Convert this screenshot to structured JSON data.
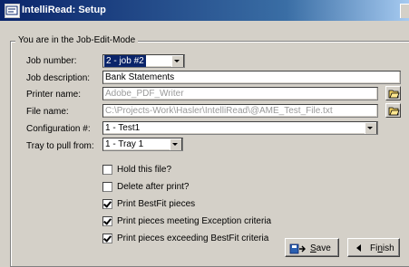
{
  "window": {
    "title": "IntelliRead: Setup"
  },
  "group": {
    "label": "You are in the Job-Edit-Mode"
  },
  "form": {
    "job_number": {
      "label": "Job number:",
      "value": "2 - job #2"
    },
    "job_description": {
      "label": "Job description:",
      "value": "Bank Statements"
    },
    "printer_name": {
      "label": "Printer name:",
      "value": "Adobe_PDF_Writer"
    },
    "file_name": {
      "label": "File name:",
      "value": "C:\\Projects-Work\\Hasler\\IntelliRead\\@AME_Test_File.txt"
    },
    "configuration": {
      "label": "Configuration #:",
      "value": "1 - Test1"
    },
    "tray": {
      "label": "Tray to pull from:",
      "value": "1 - Tray 1"
    }
  },
  "options": [
    {
      "label": "Hold this file?",
      "checked": false
    },
    {
      "label": "Delete after print?",
      "checked": false
    },
    {
      "label": "Print BestFit pieces",
      "checked": true
    },
    {
      "label": "Print pieces meeting Exception criteria",
      "checked": true
    },
    {
      "label": "Print pieces exceeding BestFit criteria",
      "checked": true
    }
  ],
  "buttons": {
    "save": {
      "mnemonic": "S",
      "rest": "ave",
      "icon": "save-arrow-icon"
    },
    "finish": {
      "pre": "Fi",
      "mnemonic": "n",
      "rest": "ish",
      "icon": "left-arrow-icon"
    }
  },
  "colors": {
    "titlebar_start": "#0a246a",
    "titlebar_end": "#a6caf0",
    "selection": "#0a246a",
    "face": "#d4d0c8"
  }
}
